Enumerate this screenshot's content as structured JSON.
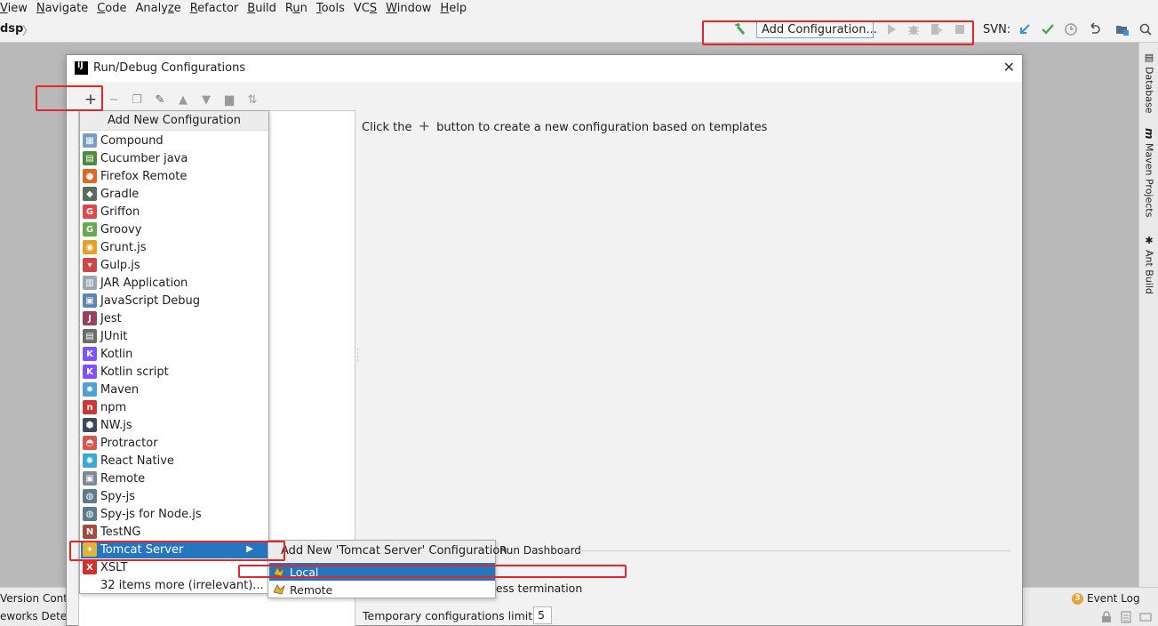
{
  "menubar": {
    "items": [
      {
        "label": "View",
        "mnemonic": "V"
      },
      {
        "label": "Navigate",
        "mnemonic": "N"
      },
      {
        "label": "Code",
        "mnemonic": "C"
      },
      {
        "label": "Analyze",
        "mnemonic": "z"
      },
      {
        "label": "Refactor",
        "mnemonic": "R"
      },
      {
        "label": "Build",
        "mnemonic": "B"
      },
      {
        "label": "Run",
        "mnemonic": "u"
      },
      {
        "label": "Tools",
        "mnemonic": "T"
      },
      {
        "label": "VCS",
        "mnemonic": "S"
      },
      {
        "label": "Window",
        "mnemonic": "W"
      },
      {
        "label": "Help",
        "mnemonic": "H"
      }
    ]
  },
  "toolbar": {
    "breadcrumb": "dsp",
    "breadcrumb_sep": "〉",
    "add_configuration": "Add Configuration...",
    "svn_label": "SVN:"
  },
  "right_strip": {
    "tabs": [
      {
        "label": "Database",
        "icon": "database-icon"
      },
      {
        "label": "Maven Projects",
        "icon": "maven-icon"
      },
      {
        "label": "Ant Build",
        "icon": "ant-icon"
      }
    ]
  },
  "status": {
    "left_line1": "Version Contro",
    "left_line2": "eworks Detec",
    "event_log": "Event Log",
    "event_count": "3"
  },
  "dialog": {
    "title": "Run/Debug Configurations",
    "logo": "IJ",
    "close": "✕",
    "hint_before": "Click the",
    "hint_plus": "+",
    "hint_after": "button to create a new configuration based on templates",
    "run_dashboard": "Run Dashboard",
    "process_termination": "cess termination",
    "temp_limit_label": "Temporary configurations limit:",
    "temp_limit_value": "5"
  },
  "popup": {
    "header": "Add New Configuration",
    "items": [
      {
        "label": "Compound",
        "color": "#7a9bc2",
        "glyph": "▦"
      },
      {
        "label": "Cucumber java",
        "color": "#4e8a3e",
        "glyph": "▤"
      },
      {
        "label": "Firefox Remote",
        "color": "#e2661f",
        "glyph": "●"
      },
      {
        "label": "Gradle",
        "color": "#5a6b5f",
        "glyph": "◆"
      },
      {
        "label": "Griffon",
        "color": "#e0474c",
        "glyph": "G"
      },
      {
        "label": "Groovy",
        "color": "#6aa84f",
        "glyph": "G"
      },
      {
        "label": "Grunt.js",
        "color": "#e4a125",
        "glyph": "◉"
      },
      {
        "label": "Gulp.js",
        "color": "#cf4647",
        "glyph": "▾"
      },
      {
        "label": "JAR Application",
        "color": "#9aa7b3",
        "glyph": "▥"
      },
      {
        "label": "JavaScript Debug",
        "color": "#5b85b5",
        "glyph": "▣"
      },
      {
        "label": "Jest",
        "color": "#99425b",
        "glyph": "J"
      },
      {
        "label": "JUnit",
        "color": "#6b6b6b",
        "glyph": "▤"
      },
      {
        "label": "Kotlin",
        "color": "#7f52ff",
        "glyph": "K"
      },
      {
        "label": "Kotlin script",
        "color": "#7f52ff",
        "glyph": "K"
      },
      {
        "label": "Maven",
        "color": "#4ea0d6",
        "glyph": "✸"
      },
      {
        "label": "npm",
        "color": "#cb3837",
        "glyph": "n"
      },
      {
        "label": "NW.js",
        "color": "#3a4a5e",
        "glyph": "⬢"
      },
      {
        "label": "Protractor",
        "color": "#d9534f",
        "glyph": "◓"
      },
      {
        "label": "React Native",
        "color": "#3aa9d6",
        "glyph": "✺"
      },
      {
        "label": "Remote",
        "color": "#7d8a96",
        "glyph": "▣"
      },
      {
        "label": "Spy-js",
        "color": "#5e7b8c",
        "glyph": "◍"
      },
      {
        "label": "Spy-js for Node.js",
        "color": "#5e7b8c",
        "glyph": "◍"
      },
      {
        "label": "TestNG",
        "color": "#a44a3f",
        "glyph": "N"
      },
      {
        "label": "Tomcat Server",
        "color": "#e0b33a",
        "glyph": "✦",
        "selected": true
      },
      {
        "label": "XSLT",
        "color": "#d22f2f",
        "glyph": "X"
      },
      {
        "label": "32 items more (irrelevant)...",
        "color": "",
        "glyph": ""
      }
    ]
  },
  "submenu": {
    "header": "Add New 'Tomcat Server' Configuration",
    "items": [
      {
        "label": "Local",
        "selected": true
      },
      {
        "label": "Remote",
        "selected": false
      }
    ]
  },
  "colors": {
    "highlight_red": "#e3262a",
    "selection_blue": "#2675bf",
    "svn_blue": "#3d8fd9",
    "svn_green": "#3ea64b"
  }
}
